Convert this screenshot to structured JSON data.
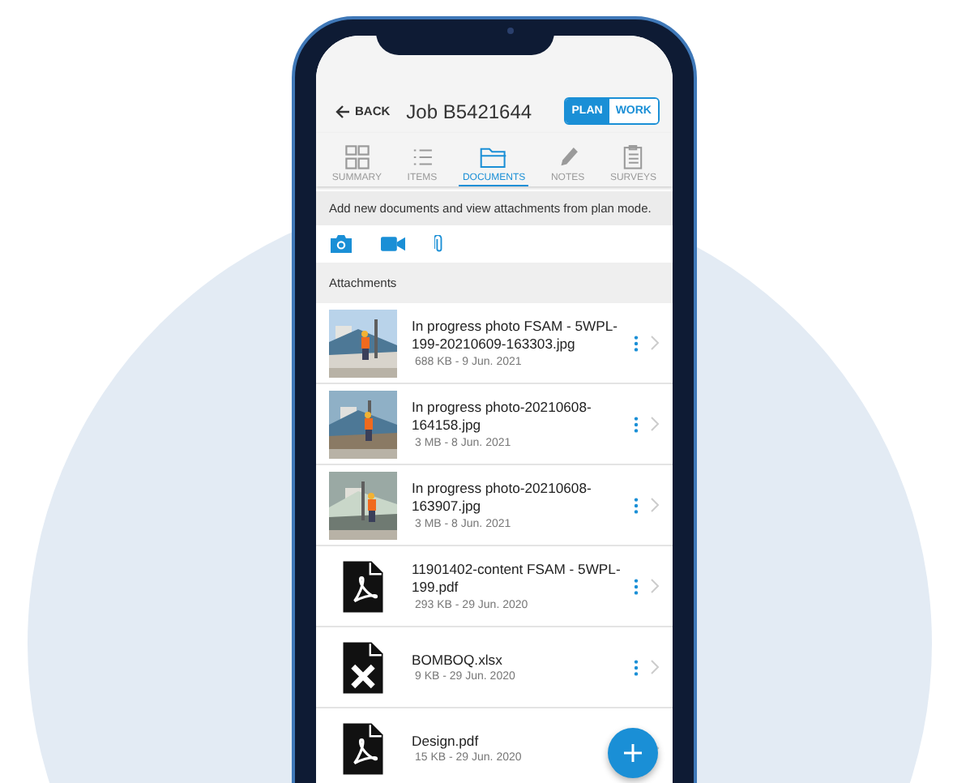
{
  "header": {
    "back": "BACK",
    "title": "Job B5421644",
    "modes": [
      {
        "label": "PLAN",
        "selected": true
      },
      {
        "label": "WORK",
        "selected": false
      }
    ]
  },
  "tabs": [
    {
      "label": "SUMMARY",
      "kind": "grid",
      "selected": false
    },
    {
      "label": "ITEMS",
      "kind": "list",
      "selected": false
    },
    {
      "label": "DOCUMENTS",
      "kind": "folder",
      "selected": true
    },
    {
      "label": "NOTES",
      "kind": "pencil",
      "selected": false
    },
    {
      "label": "SURVEYS",
      "kind": "clipboard",
      "selected": false
    }
  ],
  "info": "Add new documents and view attachments from plan mode.",
  "section_title": "Attachments",
  "attachments": [
    {
      "name": "In progress photo FSAM - 5WPL-199-20210609-163303.jpg",
      "meta": "688 KB - 9 Jun. 2021"
    },
    {
      "name": "In progress photo-20210608-164158.jpg",
      "meta": "3 MB - 8 Jun. 2021"
    },
    {
      "name": "In progress photo-20210608-163907.jpg",
      "meta": "3 MB - 8 Jun. 2021"
    },
    {
      "kind": "pdf",
      "name": "11901402-content FSAM - 5WPL-199.pdf",
      "meta": "293 KB - 29 Jun. 2020"
    },
    {
      "kind": "xlsx",
      "name": "BOMBOQ.xlsx",
      "meta": "9 KB - 29 Jun. 2020"
    },
    {
      "kind": "pdf",
      "name": "Design.pdf",
      "meta": "15 KB - 29 Jun. 2020"
    }
  ]
}
